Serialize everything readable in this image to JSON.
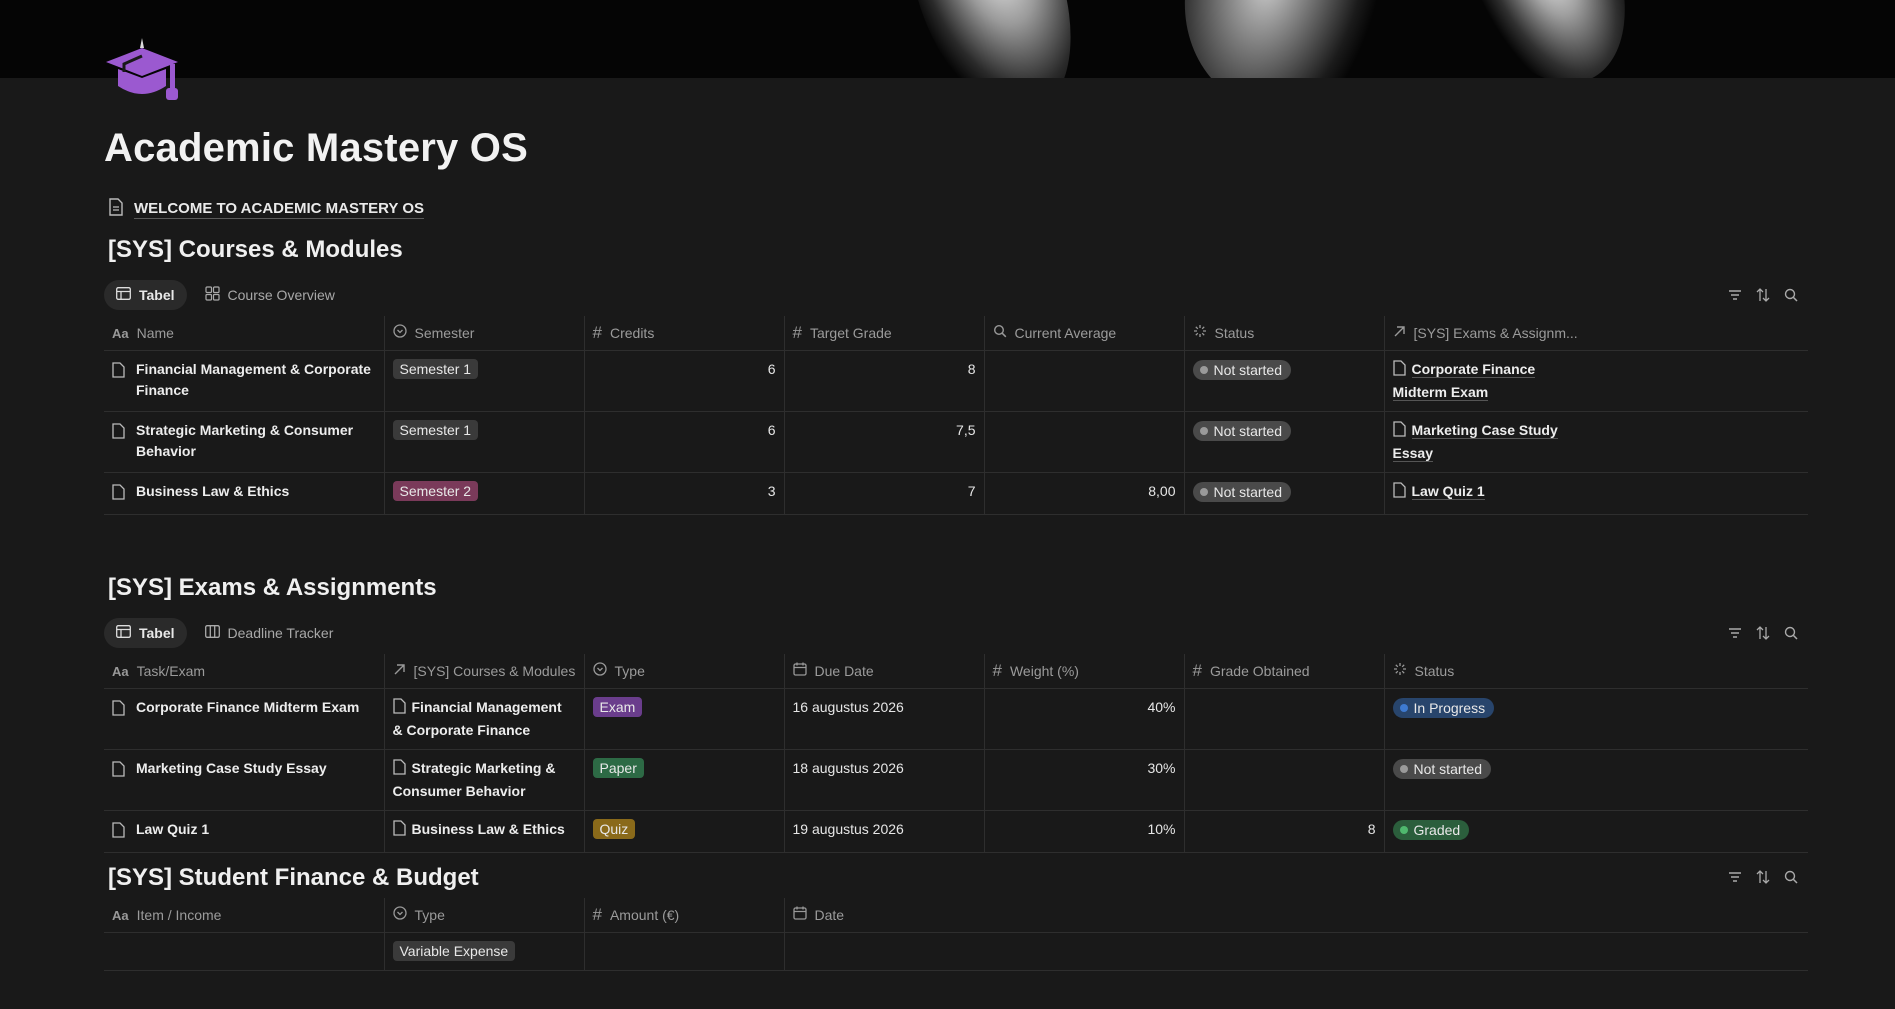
{
  "page": {
    "title": "Academic Mastery OS",
    "welcome_link": "WELCOME TO ACADEMIC MASTERY OS",
    "icon": "graduation-cap-icon"
  },
  "colors": {
    "background": "#191919",
    "icon_purple": "#9b59d0",
    "semester2_tag": "#7a3a5a",
    "exam_tag": "#6a3d8c",
    "paper_tag": "#2d6a45",
    "quiz_tag": "#8a6a1a",
    "in_progress": "#28456c",
    "graded": "#2b5e3c",
    "not_started": "#4a4a4a"
  },
  "courses": {
    "title": "[SYS] Courses & Modules",
    "tabs": [
      {
        "label": "Tabel",
        "icon": "table-icon"
      },
      {
        "label": "Course Overview",
        "icon": "gallery-icon"
      }
    ],
    "columns": [
      {
        "label": "Name",
        "icon": "text-icon"
      },
      {
        "label": "Semester",
        "icon": "select-icon"
      },
      {
        "label": "Credits",
        "icon": "number-icon"
      },
      {
        "label": "Target Grade",
        "icon": "number-icon"
      },
      {
        "label": "Current Average",
        "icon": "search-icon"
      },
      {
        "label": "Status",
        "icon": "status-icon"
      },
      {
        "label": "[SYS] Exams & Assignm...",
        "icon": "relation-arrow-icon"
      }
    ],
    "rows": [
      {
        "name": "Financial Management & Corporate Finance",
        "semester": "Semester 1",
        "credits": "6",
        "target": "8",
        "average": "",
        "status": "Not started",
        "relation": "Corporate Finance Midterm Exam"
      },
      {
        "name": "Strategic Marketing & Consumer Behavior",
        "semester": "Semester 1",
        "credits": "6",
        "target": "7,5",
        "average": "",
        "status": "Not started",
        "relation": "Marketing Case Study Essay"
      },
      {
        "name": "Business Law & Ethics",
        "semester": "Semester 2",
        "credits": "3",
        "target": "7",
        "average": "8,00",
        "status": "Not started",
        "relation": "Law Quiz 1"
      }
    ]
  },
  "exams": {
    "title": "[SYS] Exams & Assignments",
    "tabs": [
      {
        "label": "Tabel",
        "icon": "table-icon"
      },
      {
        "label": "Deadline Tracker",
        "icon": "board-icon"
      }
    ],
    "columns": [
      {
        "label": "Task/Exam",
        "icon": "text-icon"
      },
      {
        "label": "[SYS] Courses & Modules",
        "icon": "relation-arrow-icon"
      },
      {
        "label": "Type",
        "icon": "select-icon"
      },
      {
        "label": "Due Date",
        "icon": "calendar-icon"
      },
      {
        "label": "Weight (%)",
        "icon": "number-icon"
      },
      {
        "label": "Grade Obtained",
        "icon": "number-icon"
      },
      {
        "label": "Status",
        "icon": "status-icon"
      }
    ],
    "rows": [
      {
        "name": "Corporate Finance Midterm Exam",
        "course": "Financial Management & Corporate Finance",
        "type": "Exam",
        "due": "16 augustus 2026",
        "weight": "40%",
        "grade": "",
        "status": "In Progress"
      },
      {
        "name": "Marketing Case Study Essay",
        "course": "Strategic Marketing & Consumer Behavior",
        "type": "Paper",
        "due": "18 augustus 2026",
        "weight": "30%",
        "grade": "",
        "status": "Not started"
      },
      {
        "name": "Law Quiz 1",
        "course": "Business Law & Ethics",
        "type": "Quiz",
        "due": "19 augustus 2026",
        "weight": "10%",
        "grade": "8",
        "status": "Graded"
      }
    ]
  },
  "finance": {
    "title": "[SYS] Student Finance & Budget",
    "columns": [
      {
        "label": "Item / Income",
        "icon": "text-icon"
      },
      {
        "label": "Type",
        "icon": "select-icon"
      },
      {
        "label": "Amount (€)",
        "icon": "number-icon"
      },
      {
        "label": "Date",
        "icon": "calendar-icon"
      }
    ],
    "rows": [
      {
        "item": "",
        "type": "Variable Expense",
        "amount": "",
        "date": ""
      }
    ]
  }
}
